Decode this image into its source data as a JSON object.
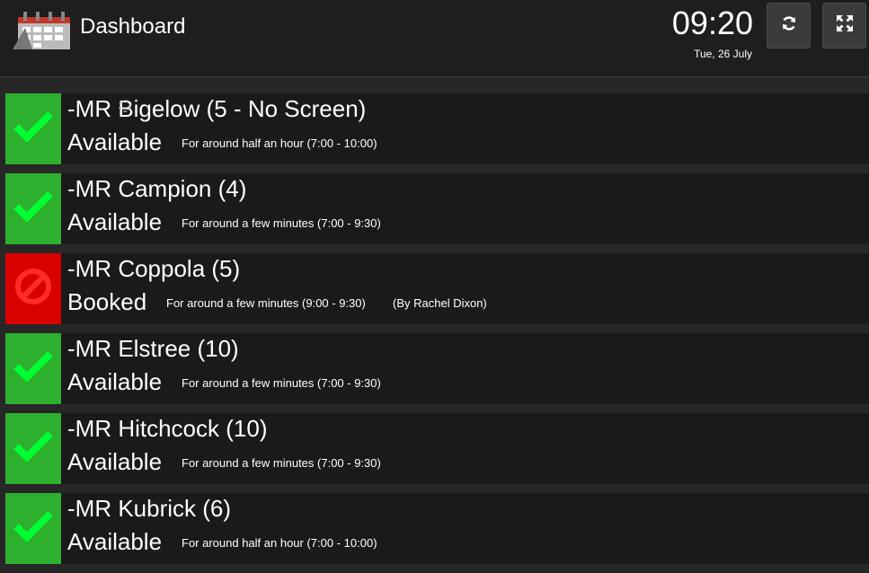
{
  "header": {
    "title": "Dashboard",
    "time": "09:20",
    "date": "Tue, 26 July",
    "refresh_icon": "refresh-icon",
    "fullscreen_icon": "fullscreen-icon"
  },
  "colors": {
    "available": "#2db02d",
    "booked": "#d90000",
    "check": "#00ff33",
    "row_bg": "#1a1a1a",
    "page_bg": "#272727"
  },
  "rooms": [
    {
      "name": "-MR Bigelow (5 - No Screen)",
      "status": "Available",
      "detail": "For around half an hour (7:00 - 10:00)",
      "by": ""
    },
    {
      "name": "-MR Campion (4)",
      "status": "Available",
      "detail": "For around a few minutes (7:00 - 9:30)",
      "by": ""
    },
    {
      "name": "-MR Coppola (5)",
      "status": "Booked",
      "detail": "For around a few minutes (9:00 - 9:30)",
      "by": "(By Rachel Dixon)"
    },
    {
      "name": "-MR Elstree (10)",
      "status": "Available",
      "detail": "For around a few minutes (7:00 - 9:30)",
      "by": ""
    },
    {
      "name": "-MR Hitchcock (10)",
      "status": "Available",
      "detail": "For around a few minutes (7:00 - 9:30)",
      "by": ""
    },
    {
      "name": "-MR Kubrick (6)",
      "status": "Available",
      "detail": "For around half an hour (7:00 - 10:00)",
      "by": ""
    }
  ]
}
